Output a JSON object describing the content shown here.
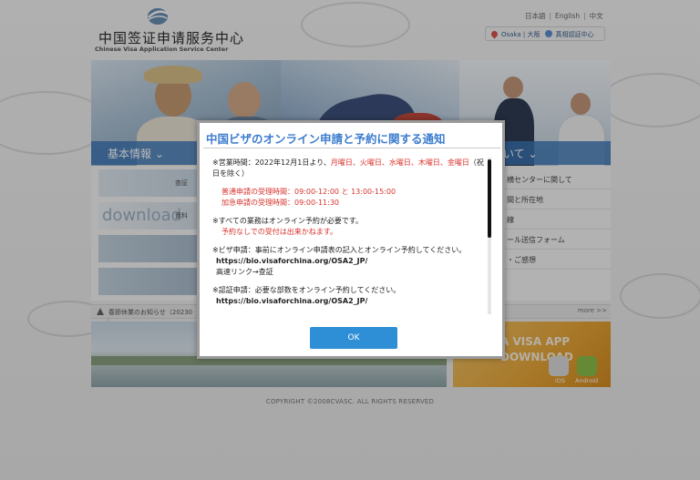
{
  "header": {
    "logo_title": "中国签证申请服务中心",
    "logo_subtitle": "Chinese Visa Application Service Center",
    "languages": [
      "日本語",
      "English",
      "中文"
    ],
    "location_label": "Osaka | 大阪",
    "authentication_label": "真相認証中心"
  },
  "nav": {
    "left_label": "基本情報",
    "right_label": "いて"
  },
  "left_tiles": {
    "tile1_label": "查証",
    "tile2_word": "download",
    "tile2_label": "資料"
  },
  "right_menu": [
    "横センターに関して",
    "間と所在地",
    "線",
    "ール送信フォーム",
    "・ご感想"
  ],
  "news": {
    "text": "春節休業のお知らせ（20230",
    "more_label": "more >>"
  },
  "app_banner": {
    "line1": "A VISA APP",
    "line2": "DOWNLOAD",
    "ios_label": "iOS",
    "android_label": "Android"
  },
  "footer": {
    "copyright": "COPYRIGHT ©2008CVASC. ALL RIGHTS RESERVED"
  },
  "modal": {
    "title": "中国ビザのオンライン申請と予約に関する通知",
    "hours_prefix": "※営業時間：2022年12月1日より、",
    "hours_days": "月曜日、火曜日、水曜日、木曜日、金曜日",
    "hours_suffix": "（祝日を除く）",
    "normal_hours": "普通申請の受理時間：09:00-12:00 と 13:00-15:00",
    "express_hours": "加急申請の受理時間：09:00-11:30",
    "reservation_required": "※すべての業務はオンライン予約が必要です。",
    "no_reservation": "予約なしでの受付は出来かねます。",
    "visa_intro": "※ビザ申請：事前にオンライン申請表の記入とオンライン予約してください。",
    "visa_url": "https://bio.visaforchina.org/OSA2_JP/",
    "visa_link_label": "高速リンク→查証",
    "auth_intro": "※認証申請：必要な部数をオンライン予約してください。",
    "auth_url": "https://bio.visaforchina.org/OSA2_JP/",
    "ok_label": "OK"
  },
  "colors": {
    "accent": "#3d7ccf",
    "warning_red": "#d8322c",
    "button_blue": "#2e8ed6"
  }
}
